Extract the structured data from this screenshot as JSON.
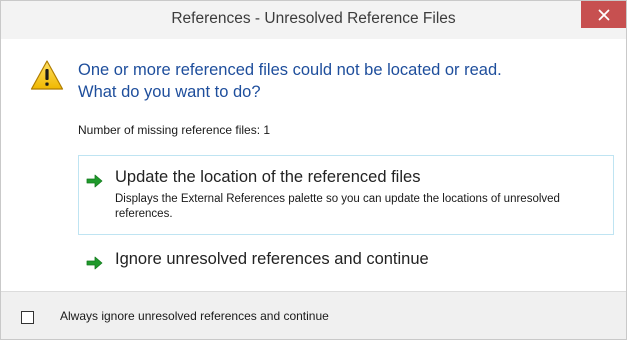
{
  "window": {
    "title": "References - Unresolved Reference Files",
    "close_icon": "close-icon"
  },
  "main": {
    "icon": "warning-icon",
    "instruction_line1": "One or more referenced files could not be located or read.",
    "instruction_line2": "What do you want to do?",
    "missing_count_text": "Number of missing reference files: 1"
  },
  "commands": [
    {
      "icon": "green-arrow-icon",
      "title": "Update the location of the referenced files",
      "description": "Displays the External References palette so you can update the locations of unresolved references."
    },
    {
      "icon": "green-arrow-icon",
      "title": "Ignore unresolved references and continue",
      "description": ""
    }
  ],
  "footer": {
    "checkbox_label": "Always ignore unresolved references and continue",
    "checkbox_checked": false
  },
  "colors": {
    "instruction_blue": "#1e4e9c",
    "close_red": "#c75050",
    "arrow_green": "#1f9a2b",
    "hover_border": "#bfe4f2",
    "warning_yellow": "#f6c700"
  }
}
